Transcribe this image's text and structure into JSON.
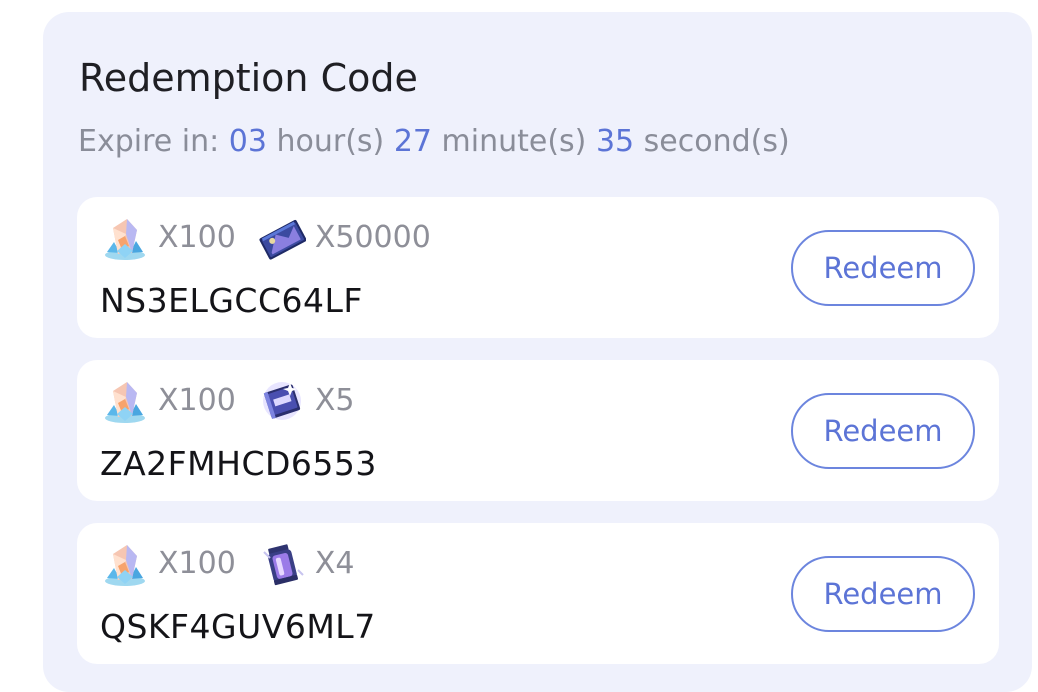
{
  "header": {
    "title": "Redemption Code"
  },
  "expiry": {
    "prefix": "Expire in:",
    "hours": "03",
    "hours_unit": "hour(s)",
    "minutes": "27",
    "minutes_unit": "minute(s)",
    "seconds": "35",
    "seconds_unit": "second(s)"
  },
  "codes": [
    {
      "rewards": [
        {
          "icon": "crystal-icon",
          "qty": "X100"
        },
        {
          "icon": "ticket-icon",
          "qty": "X50000"
        }
      ],
      "code": "NS3ELGCC64LF",
      "button": "Redeem"
    },
    {
      "rewards": [
        {
          "icon": "crystal-icon",
          "qty": "X100"
        },
        {
          "icon": "book-icon",
          "qty": "X5"
        }
      ],
      "code": "ZA2FMHCD6553",
      "button": "Redeem"
    },
    {
      "rewards": [
        {
          "icon": "crystal-icon",
          "qty": "X100"
        },
        {
          "icon": "canister-icon",
          "qty": "X4"
        }
      ],
      "code": "QSKF4GUV6ML7",
      "button": "Redeem"
    }
  ],
  "colors": {
    "panel_bg": "#eff1fc",
    "accent": "#5c74d6",
    "muted_text": "#8a8d99"
  }
}
